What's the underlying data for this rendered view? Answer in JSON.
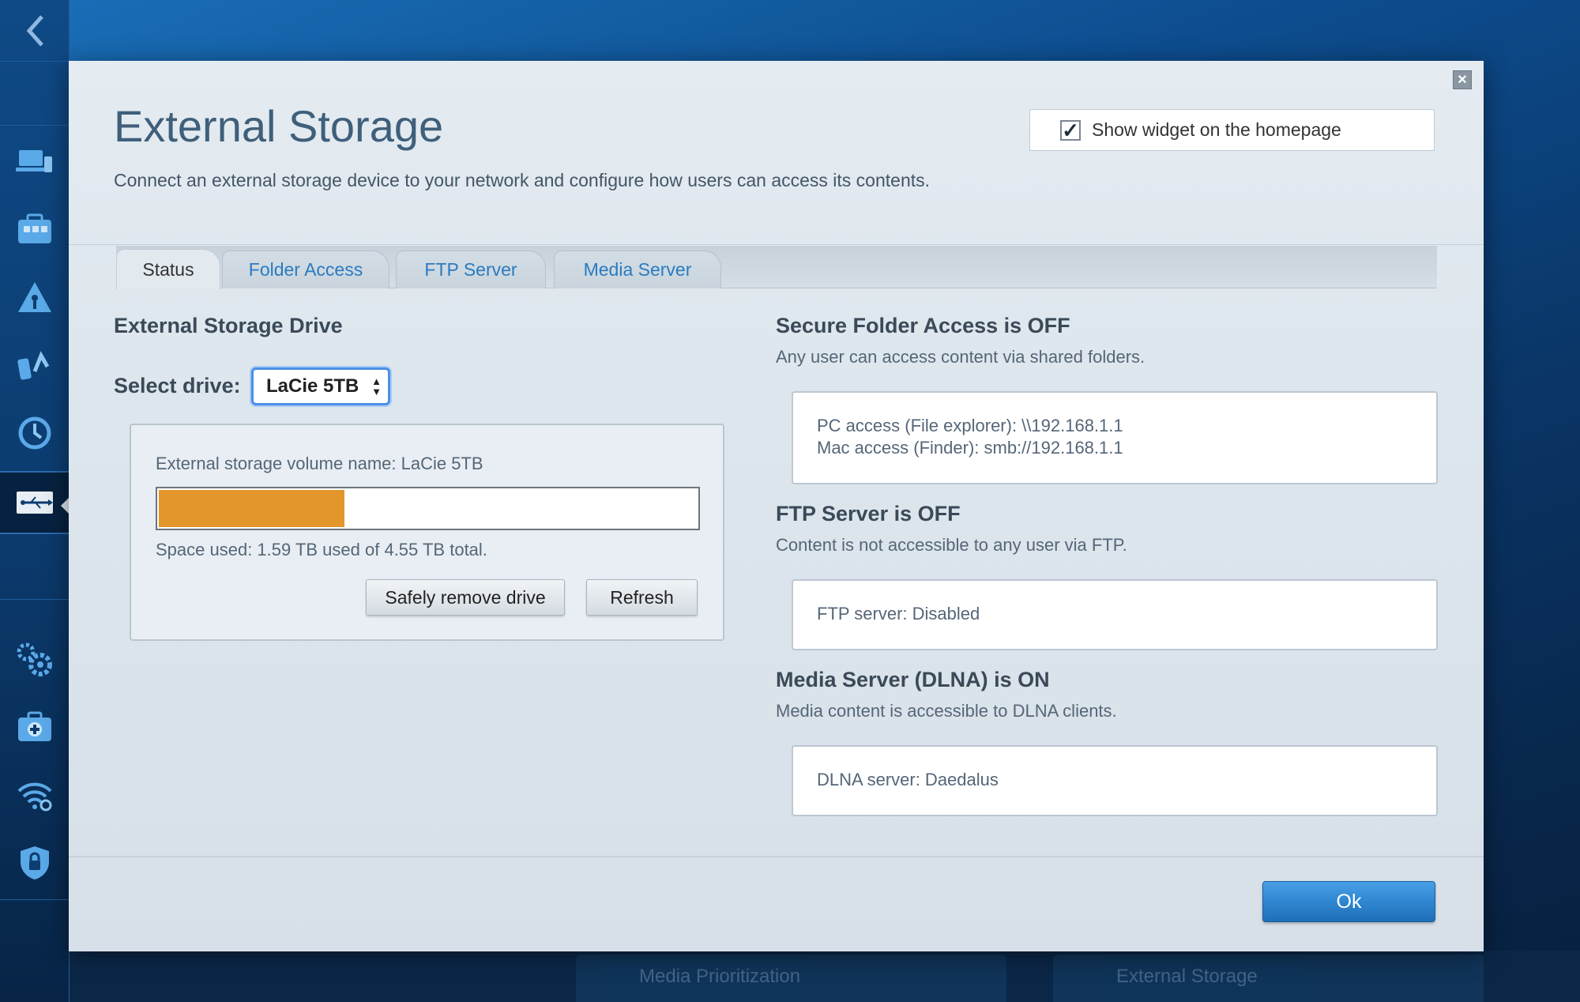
{
  "dialog": {
    "title": "External Storage",
    "subtitle": "Connect an external storage device to your network and configure how users can access its contents.",
    "show_widget_label": "Show widget on the homepage",
    "show_widget_checked": true,
    "ok_label": "Ok"
  },
  "tabs": [
    {
      "label": "Status",
      "active": true
    },
    {
      "label": "Folder Access",
      "active": false
    },
    {
      "label": "FTP Server",
      "active": false
    },
    {
      "label": "Media Server",
      "active": false
    }
  ],
  "drive": {
    "section_title": "External Storage Drive",
    "select_label": "Select drive:",
    "selected_drive": "LaCie 5TB",
    "volume_name": "External storage volume name: LaCie 5TB",
    "space_used_text": "Space used: 1.59 TB used of 4.55 TB total.",
    "used_tb": 1.59,
    "total_tb": 4.55,
    "bar_color": "#e3962b",
    "safely_remove_label": "Safely remove drive",
    "refresh_label": "Refresh"
  },
  "folder_access": {
    "title": "Secure Folder Access is OFF",
    "desc": "Any user can access content via shared folders.",
    "pc_access": "PC access (File explorer): \\\\192.168.1.1",
    "mac_access": "Mac access (Finder): smb://192.168.1.1"
  },
  "ftp": {
    "title": "FTP Server is OFF",
    "desc": "Content is not accessible to any user via FTP.",
    "status": "FTP server: Disabled"
  },
  "media": {
    "title": "Media Server (DLNA) is ON",
    "desc": "Media content is accessible to DLNA clients.",
    "status": "DLNA server: Daedalus"
  },
  "background_widgets": [
    "Media Prioritization",
    "External Storage"
  ],
  "sidebar": {
    "icons": [
      "back-arrow-icon",
      "devices-icon",
      "parental-controls-icon",
      "guest-access-icon",
      "speed-test-icon",
      "history-icon",
      "usb-storage-icon",
      "settings-icon",
      "troubleshooting-icon",
      "wifi-settings-icon",
      "security-icon"
    ]
  },
  "colors": {
    "accent": "#2f86d1",
    "tab_text": "#2a7bc0",
    "storage_bar": "#e3962b"
  }
}
